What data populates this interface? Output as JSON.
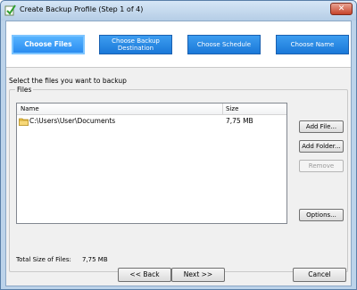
{
  "window": {
    "title": "Create Backup Profile (Step 1 of 4)",
    "close_symbol": "✕"
  },
  "steps": [
    {
      "label": "Choose Files",
      "active": true
    },
    {
      "label": "Choose Backup Destination",
      "active": false
    },
    {
      "label": "Choose Schedule",
      "active": false
    },
    {
      "label": "Choose Name",
      "active": false
    }
  ],
  "instruction": "Select the files you want to backup",
  "files_group": {
    "label": "Files",
    "columns": {
      "name": "Name",
      "size": "Size"
    },
    "rows": [
      {
        "name": "C:\\Users\\User\\Documents",
        "size": "7,75 MB",
        "icon": "folder-icon"
      }
    ],
    "total_label": "Total Size of Files:",
    "total_value": "7,75 MB"
  },
  "side_buttons": {
    "add_file": "Add File...",
    "add_folder": "Add Folder...",
    "remove": "Remove",
    "options": "Options..."
  },
  "nav_buttons": {
    "back": "<< Back",
    "next": "Next >>",
    "cancel": "Cancel"
  },
  "colors": {
    "step_fill": "#1a78d8",
    "step_active_fill": "#2a8cf0",
    "title_bar": "#b5cde6"
  }
}
